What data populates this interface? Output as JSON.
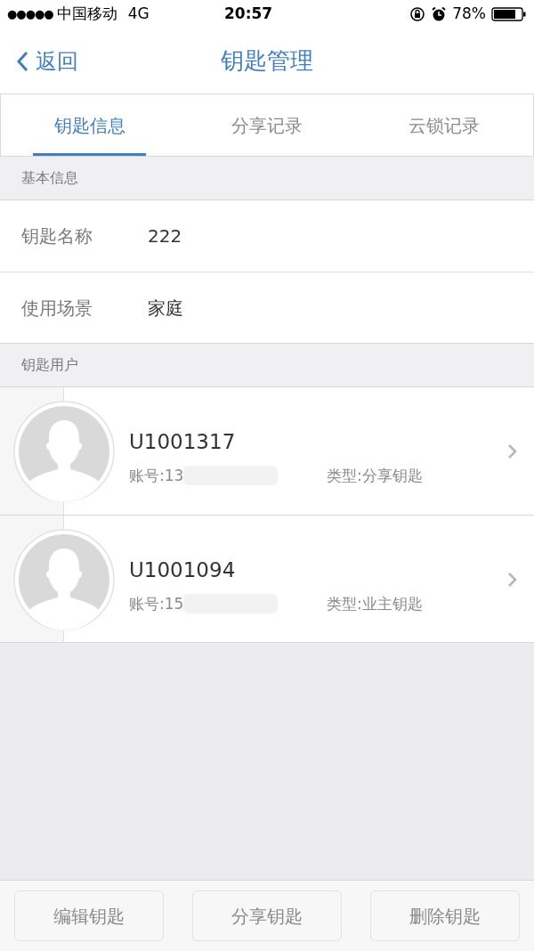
{
  "status_bar": {
    "signal_dots": "●●●●●",
    "carrier": "中国移动",
    "network": "4G",
    "time": "20:57",
    "battery": "78%"
  },
  "nav": {
    "back": "返回",
    "title": "钥匙管理"
  },
  "tabs": [
    {
      "label": "钥匙信息",
      "selected": true
    },
    {
      "label": "分享记录",
      "selected": false
    },
    {
      "label": "云锁记录",
      "selected": false
    }
  ],
  "sections": [
    {
      "header": "基本信息",
      "fields": [
        {
          "label": "钥匙名称",
          "value": "222"
        },
        {
          "label": "使用场景",
          "value": "家庭"
        }
      ]
    },
    {
      "header": "钥匙用户",
      "users": [
        {
          "name": "U1001317",
          "account": "账号:13",
          "type": "类型:分享钥匙"
        },
        {
          "name": "U1001094",
          "account": "账号:15",
          "type": "类型:业主钥匙"
        }
      ]
    }
  ],
  "buttons": [
    "编辑钥匙",
    "分享钥匙",
    "删除钥匙"
  ]
}
